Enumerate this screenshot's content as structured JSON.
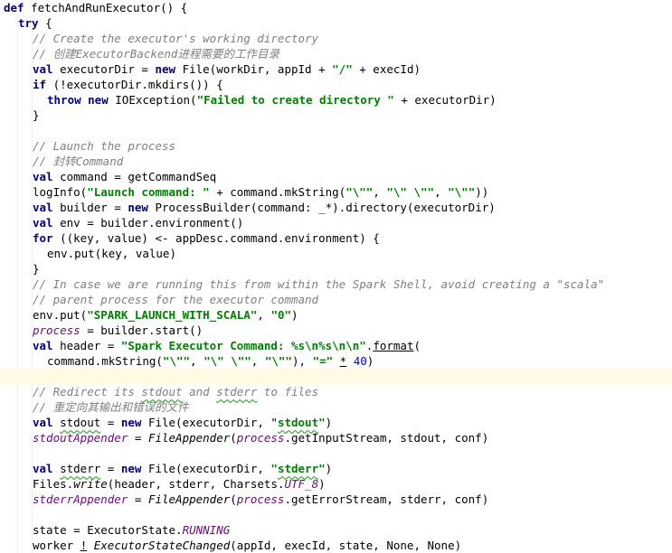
{
  "editor": {
    "lines": [
      {
        "indent": 0,
        "tokens": [
          {
            "t": "def ",
            "c": "kw"
          },
          {
            "t": "fetchAndRunExecutor() {"
          }
        ]
      },
      {
        "indent": 1,
        "tokens": [
          {
            "t": "try ",
            "c": "kw"
          },
          {
            "t": "{"
          }
        ]
      },
      {
        "indent": 2,
        "tokens": [
          {
            "t": "// Create the executor's working directory",
            "c": "cmt"
          }
        ]
      },
      {
        "indent": 2,
        "tokens": [
          {
            "t": "// 创建ExecutorBackend进程需要的工作目录",
            "c": "cmt"
          }
        ]
      },
      {
        "indent": 2,
        "tokens": [
          {
            "t": "val ",
            "c": "kw"
          },
          {
            "t": "executorDir = "
          },
          {
            "t": "new ",
            "c": "kw"
          },
          {
            "t": "File(workDir, appId + "
          },
          {
            "t": "\"/\"",
            "c": "str"
          },
          {
            "t": " + execId)"
          }
        ]
      },
      {
        "indent": 2,
        "tokens": [
          {
            "t": "if ",
            "c": "kw"
          },
          {
            "t": "(!executorDir.mkdirs()) {"
          }
        ]
      },
      {
        "indent": 3,
        "tokens": [
          {
            "t": "throw new ",
            "c": "kw"
          },
          {
            "t": "IOException("
          },
          {
            "t": "\"Failed to create directory \"",
            "c": "str"
          },
          {
            "t": " + executorDir)"
          }
        ]
      },
      {
        "indent": 2,
        "tokens": [
          {
            "t": "}"
          }
        ]
      },
      {
        "indent": 0,
        "tokens": []
      },
      {
        "indent": 2,
        "tokens": [
          {
            "t": "// Launch the process",
            "c": "cmt"
          }
        ]
      },
      {
        "indent": 2,
        "tokens": [
          {
            "t": "// 封转Command",
            "c": "cmt"
          }
        ]
      },
      {
        "indent": 2,
        "tokens": [
          {
            "t": "val ",
            "c": "kw"
          },
          {
            "t": "command = getCommandSeq"
          }
        ]
      },
      {
        "indent": 2,
        "tokens": [
          {
            "t": "logInfo("
          },
          {
            "t": "\"Launch command: \"",
            "c": "str"
          },
          {
            "t": " + command.mkString("
          },
          {
            "t": "\"\\\"\"",
            "c": "str"
          },
          {
            "t": ", "
          },
          {
            "t": "\"\\\" \\\"\"",
            "c": "str"
          },
          {
            "t": ", "
          },
          {
            "t": "\"\\\"\"",
            "c": "str"
          },
          {
            "t": "))"
          }
        ]
      },
      {
        "indent": 2,
        "tokens": [
          {
            "t": "val ",
            "c": "kw"
          },
          {
            "t": "builder = "
          },
          {
            "t": "new ",
            "c": "kw"
          },
          {
            "t": "ProcessBuilder(command: _*).directory(executorDir)"
          }
        ]
      },
      {
        "indent": 2,
        "tokens": [
          {
            "t": "val ",
            "c": "kw"
          },
          {
            "t": "env = builder.environment()"
          }
        ]
      },
      {
        "indent": 2,
        "tokens": [
          {
            "t": "for ",
            "c": "kw"
          },
          {
            "t": "((key, value) <- appDesc.command.environment) {"
          }
        ]
      },
      {
        "indent": 3,
        "tokens": [
          {
            "t": "env.put(key, value)"
          }
        ]
      },
      {
        "indent": 2,
        "tokens": [
          {
            "t": "}"
          }
        ]
      },
      {
        "indent": 2,
        "tokens": [
          {
            "t": "// In case we are running this from within the Spark Shell, avoid creating a \"scala\"",
            "c": "cmt"
          }
        ]
      },
      {
        "indent": 2,
        "tokens": [
          {
            "t": "// parent process for the executor command",
            "c": "cmt"
          }
        ]
      },
      {
        "indent": 2,
        "tokens": [
          {
            "t": "env.put("
          },
          {
            "t": "\"SPARK_LAUNCH_WITH_SCALA\"",
            "c": "str"
          },
          {
            "t": ", "
          },
          {
            "t": "\"0\"",
            "c": "str"
          },
          {
            "t": ")"
          }
        ]
      },
      {
        "indent": 2,
        "tokens": [
          {
            "t": "process",
            "c": "var"
          },
          {
            "t": " = builder.start()"
          }
        ]
      },
      {
        "indent": 2,
        "tokens": [
          {
            "t": "val ",
            "c": "kw"
          },
          {
            "t": "header = "
          },
          {
            "t": "\"Spark Executor Command: %s\\n%s\\n\\n\"",
            "c": "str"
          },
          {
            "t": "."
          },
          {
            "t": "format",
            "c": "undl"
          },
          {
            "t": "("
          }
        ]
      },
      {
        "indent": 3,
        "tokens": [
          {
            "t": "command.mkString("
          },
          {
            "t": "\"\\\"\"",
            "c": "str"
          },
          {
            "t": ", "
          },
          {
            "t": "\"\\\" \\\"\"",
            "c": "str"
          },
          {
            "t": ", "
          },
          {
            "t": "\"\\\"\"",
            "c": "str"
          },
          {
            "t": "), "
          },
          {
            "t": "\"=\"",
            "c": "str"
          },
          {
            "t": " "
          },
          {
            "t": "*",
            "c": "undl"
          },
          {
            "t": " "
          },
          {
            "t": "40",
            "c": "num"
          },
          {
            "t": ")"
          }
        ]
      },
      {
        "indent": 0,
        "tokens": [],
        "current": true
      },
      {
        "indent": 2,
        "tokens": [
          {
            "t": "// Redirect its ",
            "c": "cmt"
          },
          {
            "t": "stdout",
            "c": "cmt typo"
          },
          {
            "t": " and ",
            "c": "cmt"
          },
          {
            "t": "stderr",
            "c": "cmt typo"
          },
          {
            "t": " to files",
            "c": "cmt"
          }
        ]
      },
      {
        "indent": 2,
        "tokens": [
          {
            "t": "// 重定向其输出和错误的文件",
            "c": "cmt"
          }
        ]
      },
      {
        "indent": 2,
        "tokens": [
          {
            "t": "val ",
            "c": "kw"
          },
          {
            "t": "stdout",
            "c": "typo"
          },
          {
            "t": " = "
          },
          {
            "t": "new ",
            "c": "kw"
          },
          {
            "t": "File(executorDir, "
          },
          {
            "t": "\""
          },
          {
            "t": "stdout",
            "c": "str typo"
          },
          {
            "t": "\"",
            "c": "str"
          },
          {
            "t": ")"
          }
        ]
      },
      {
        "indent": 2,
        "tokens": [
          {
            "t": "stdoutAppender",
            "c": "var"
          },
          {
            "t": " = "
          },
          {
            "t": "FileAppender",
            "c": "it"
          },
          {
            "t": "("
          },
          {
            "t": "process",
            "c": "var"
          },
          {
            "t": ".getInputStream, stdout, conf)"
          }
        ]
      },
      {
        "indent": 0,
        "tokens": []
      },
      {
        "indent": 2,
        "tokens": [
          {
            "t": "val ",
            "c": "kw"
          },
          {
            "t": "stderr",
            "c": "typo"
          },
          {
            "t": " = "
          },
          {
            "t": "new ",
            "c": "kw"
          },
          {
            "t": "File(executorDir, "
          },
          {
            "t": "\"",
            "c": "str"
          },
          {
            "t": "stderr",
            "c": "str typo"
          },
          {
            "t": "\"",
            "c": "str"
          },
          {
            "t": ")"
          }
        ]
      },
      {
        "indent": 2,
        "tokens": [
          {
            "t": "Files."
          },
          {
            "t": "write",
            "c": "it"
          },
          {
            "t": "(header, stderr, Charsets."
          },
          {
            "t": "UTF_8",
            "c": "cn"
          },
          {
            "t": ")"
          }
        ]
      },
      {
        "indent": 2,
        "tokens": [
          {
            "t": "stderrAppender",
            "c": "var"
          },
          {
            "t": " = "
          },
          {
            "t": "FileAppender",
            "c": "it"
          },
          {
            "t": "("
          },
          {
            "t": "process",
            "c": "var"
          },
          {
            "t": ".getErrorStream, stderr, conf)"
          }
        ]
      },
      {
        "indent": 0,
        "tokens": []
      },
      {
        "indent": 2,
        "tokens": [
          {
            "t": "state = ExecutorState."
          },
          {
            "t": "RUNNING",
            "c": "cn"
          }
        ]
      },
      {
        "indent": 2,
        "tokens": [
          {
            "t": "worker "
          },
          {
            "t": "!",
            "c": "undl"
          },
          {
            "t": " "
          },
          {
            "t": "ExecutorStateChanged",
            "c": "it"
          },
          {
            "t": "(appId, execId, state, None, None)"
          }
        ]
      }
    ]
  }
}
